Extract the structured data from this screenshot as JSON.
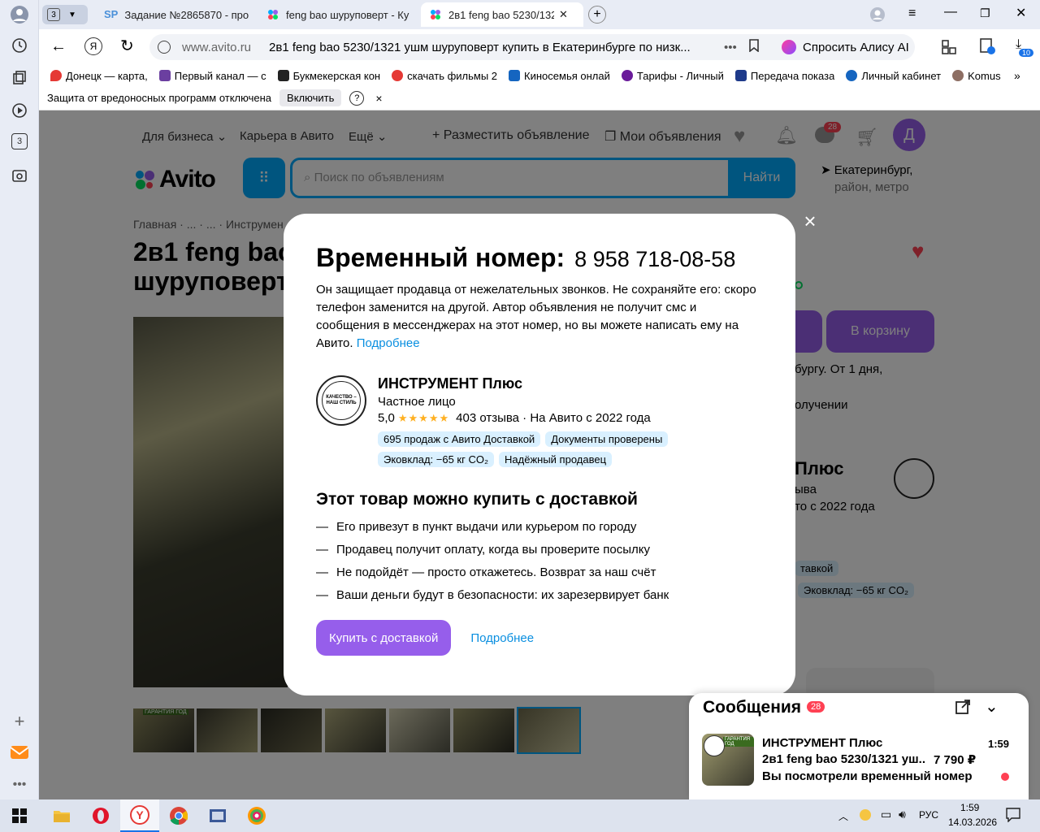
{
  "browser": {
    "tab_counter": "3",
    "tabs": [
      {
        "label": "Задание №2865870 - про"
      },
      {
        "label": "feng bao шуруповерт - Ку"
      },
      {
        "label": "2в1 feng bao 5230/132"
      }
    ],
    "address_domain": "www.avito.ru",
    "address_title": "2в1 feng bao 5230/1321 ушм шуруповерт купить в Екатеринбурге по низк...",
    "alice_label": "Спросить Алису AI",
    "downloads_badge": "10",
    "bookmarks": [
      {
        "label": "Донецк — карта,",
        "color": "#e53935"
      },
      {
        "label": "Первый канал — с",
        "color": "#6b3fa0"
      },
      {
        "label": "Букмекерская кон",
        "color": "#222222"
      },
      {
        "label": "скачать фильмы 2",
        "color": "#e53935"
      },
      {
        "label": "Киносемья онлай",
        "color": "#1565c0"
      },
      {
        "label": "Тарифы - Личный",
        "color": "#6a1b9a"
      },
      {
        "label": "Передача показа",
        "color": "#1e3a8a"
      },
      {
        "label": "Личный кабинет",
        "color": "#1565c0"
      },
      {
        "label": "Komus",
        "color": "#8d6e63"
      }
    ],
    "infobar_text": "Защита от вредоносных программ отключена",
    "infobar_enable": "Включить",
    "infobar_help": "?",
    "infobar_close": "×",
    "rail_counter": "3"
  },
  "site": {
    "nav_business": "Для бизнеса",
    "nav_career": "Карьера в Авито",
    "nav_more": "Ещё",
    "post_ad": "Разместить объявление",
    "my_ads": "Мои объявления",
    "messages_badge": "28",
    "avatar_letter": "Д",
    "logo": "Avito",
    "search_placeholder": "Поиск по объявлениям",
    "search_button": "Найти",
    "location_city": "Екатеринбург,",
    "location_sub": "район, метро",
    "breadcrumb": "Главная · ... · ... · Инструмен",
    "title_line1": "2в1 feng bao",
    "title_line2": "шуруповерт",
    "cart_button": "В корзину",
    "delivery_frag1": "бургу. От 1 дня,",
    "delivery_frag2": "олучении",
    "seller_frag_name": "Плюс",
    "seller_frag_reviews": "ыва",
    "seller_frag_since": "то с 2022 года",
    "tag_frag_delivery": "тавкой",
    "tag_frag_eco": "Эковклад: −65 кг CO₂"
  },
  "modal": {
    "title": "Временный номер:",
    "phone": "8 958 718-08-58",
    "description": "Он защищает продавца от нежелательных звонков. Не сохраняйте его: скоро телефон заменится на другой. Автор объявления не получит смс и сообщения в мессенджерах на этот номер, но вы можете написать ему на Авито.",
    "desc_link": "Подробнее",
    "seal_text": "КАЧЕСТВО – НАШ СТИЛЬ",
    "seller_name": "ИНСТРУМЕНТ Плюс",
    "seller_type": "Частное лицо",
    "rating": "5,0",
    "stars": "★★★★★",
    "reviews": "403 отзыва · На Авито с 2022 года",
    "tags": [
      "695 продаж с Авито Доставкой",
      "Документы проверены",
      "Эковклад: −65 кг CO₂",
      "Надёжный продавец"
    ],
    "delivery_heading": "Этот товар можно купить с доставкой",
    "bullets": [
      "Его привезут в пункт выдачи или курьером по городу",
      "Продавец получит оплату, когда вы проверите посылку",
      "Не подойдёт — просто откажетесь. Возврат за наш счёт",
      "Ваши деньги будут в безопасности: их зарезервирует банк"
    ],
    "buy_button": "Купить с доставкой",
    "more_link": "Подробнее",
    "close": "×"
  },
  "messages": {
    "title": "Сообщения",
    "badge": "28",
    "sender": "ИНСТРУМЕНТ Плюс",
    "time": "1:59",
    "item": "2в1 feng bao 5230/1321 уш...",
    "price": "7 790 ₽",
    "preview": "Вы посмотрели временный номер",
    "thumb_label": "ГАРАНТИЯ ГОД"
  },
  "thumbnail_label": "ГАРАНТИЯ ГОД",
  "taskbar": {
    "lang": "РУС",
    "time": "1:59",
    "date": "14.03.2026"
  }
}
